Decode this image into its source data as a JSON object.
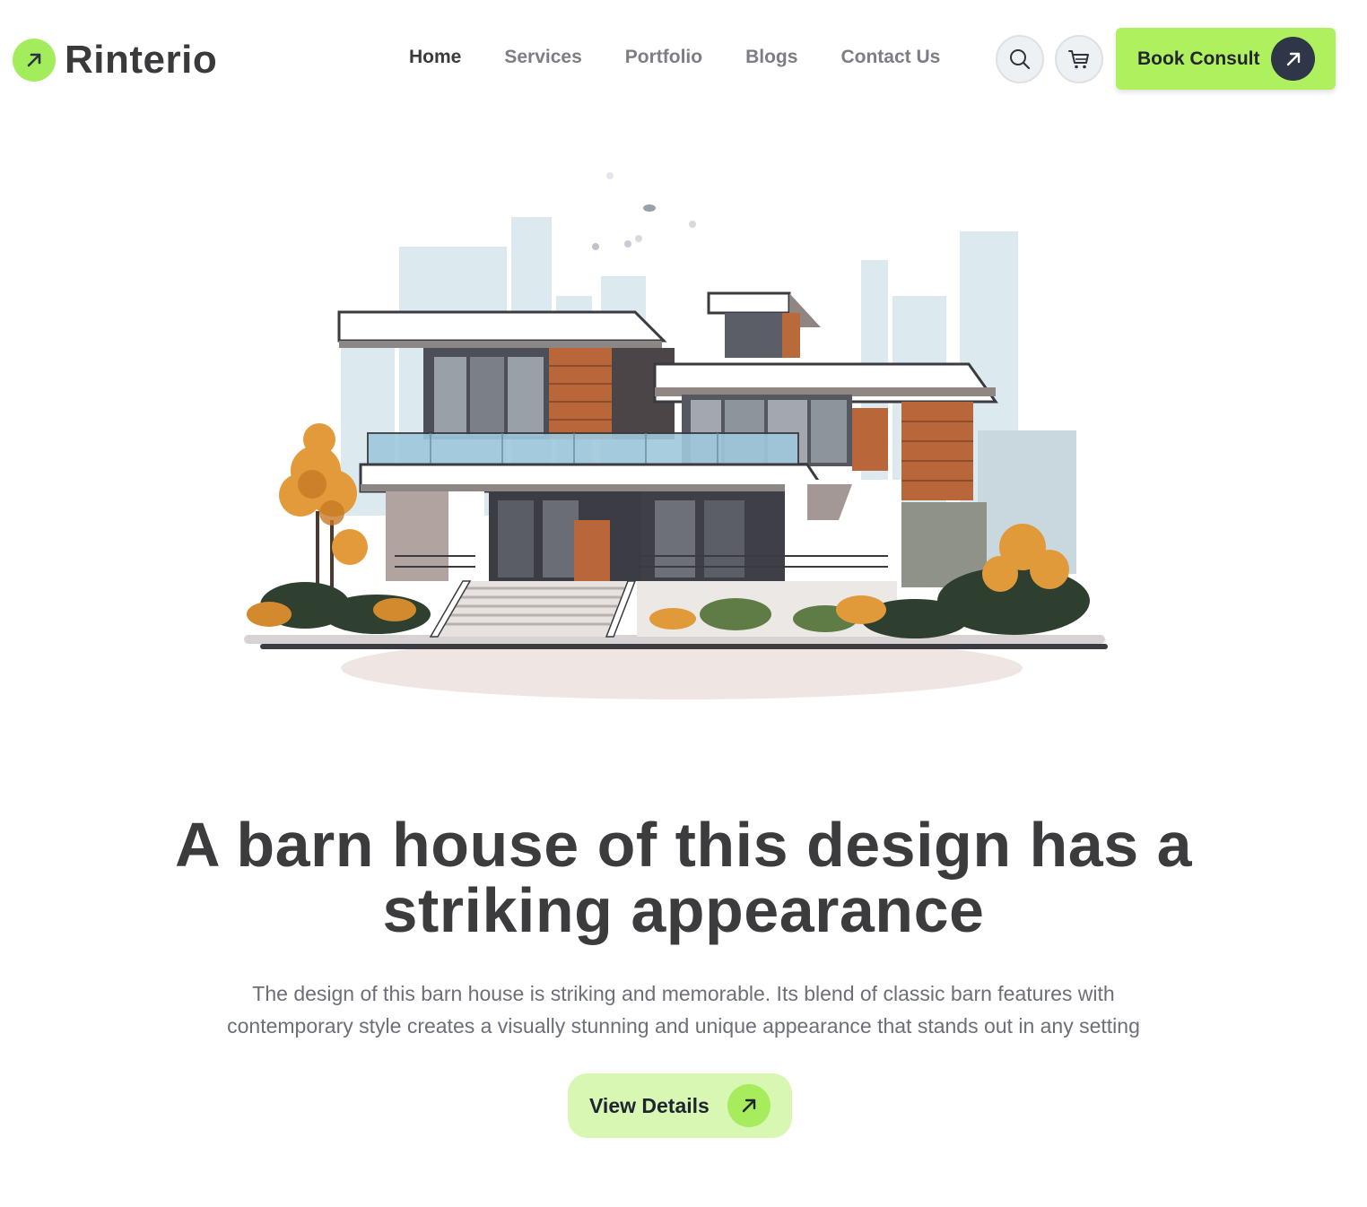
{
  "brand": {
    "name": "Rinterio",
    "icon": "arrow-up-right-icon",
    "accent": "#a3ec5b"
  },
  "nav": {
    "items": [
      {
        "label": "Home",
        "active": true
      },
      {
        "label": "Services",
        "active": false
      },
      {
        "label": "Portfolio",
        "active": false
      },
      {
        "label": "Blogs",
        "active": false
      },
      {
        "label": "Contact Us",
        "active": false
      }
    ]
  },
  "header_actions": {
    "search_icon": "search-icon",
    "cart_icon": "cart-icon",
    "cta_label": "Book Consult",
    "cta_icon": "arrow-up-right-icon"
  },
  "hero": {
    "image": "modern-house-illustration",
    "title_line1": "A barn house of this design has a",
    "title_line2": "striking appearance",
    "description_line1": "The design of this barn house is striking and memorable. Its blend of classic barn features with",
    "description_line2": "contemporary style creates a visually stunning and unique appearance that stands out in any setting",
    "button_label": "View Details",
    "button_icon": "arrow-up-right-icon"
  },
  "colors": {
    "accent": "#aef05e",
    "accent_light": "#d7f7b2",
    "dark": "#2f3647",
    "text": "#3c3c3e",
    "muted": "#6c6f78"
  }
}
